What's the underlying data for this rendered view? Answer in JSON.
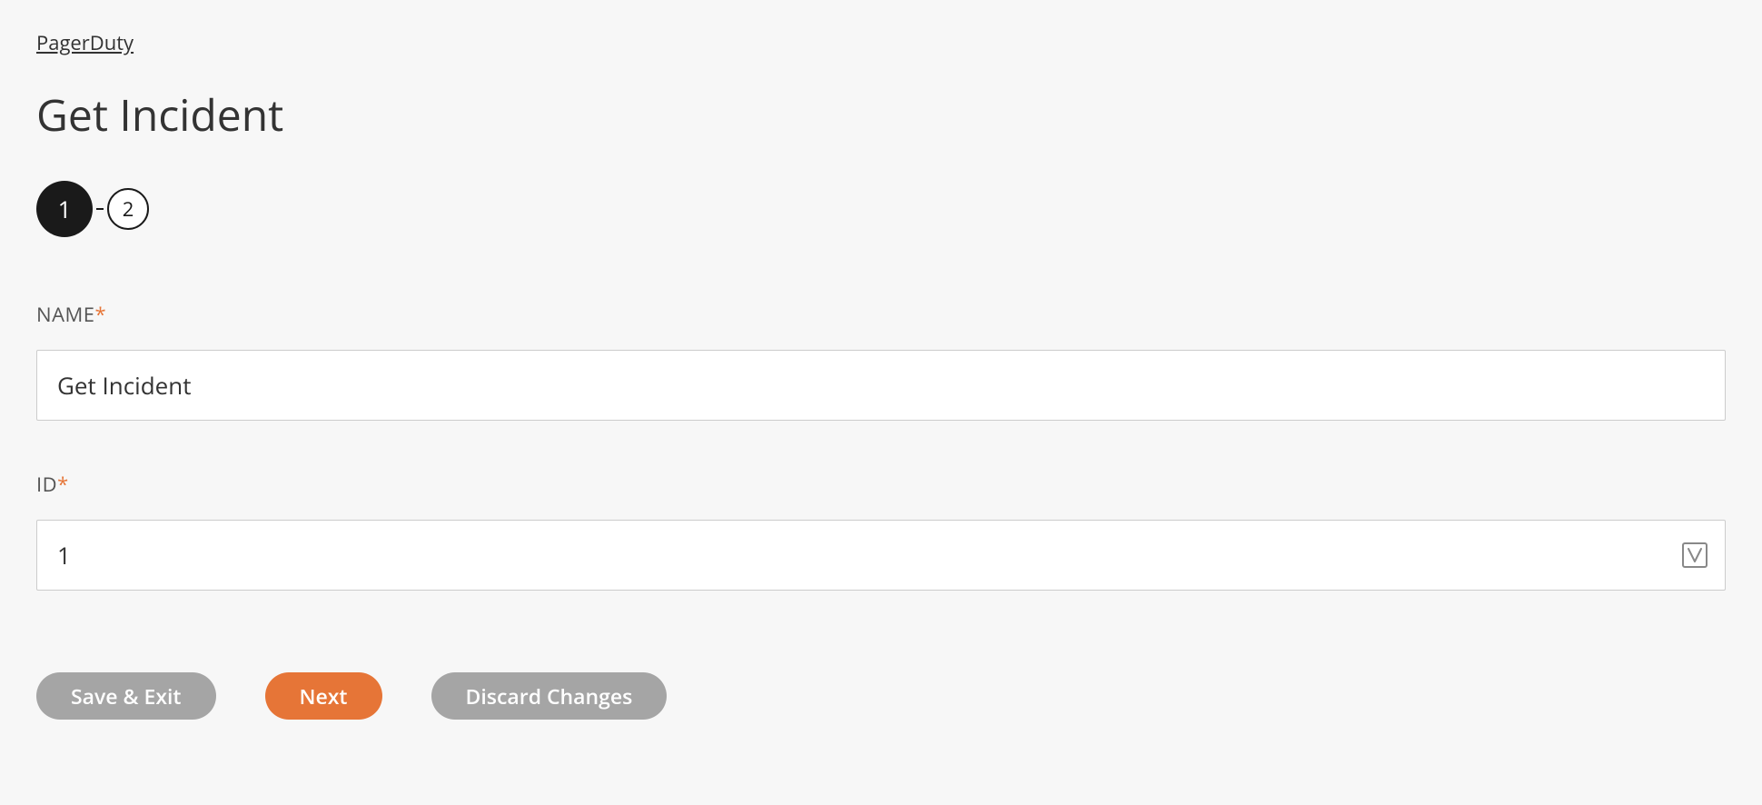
{
  "breadcrumb": "PagerDuty",
  "title": "Get Incident",
  "stepper": {
    "steps": [
      "1",
      "2"
    ],
    "activeIndex": 0
  },
  "form": {
    "name": {
      "label": "NAME",
      "required": "*",
      "value": "Get Incident"
    },
    "id": {
      "label": "ID",
      "required": "*",
      "value": "1"
    }
  },
  "buttons": {
    "saveExit": "Save & Exit",
    "next": "Next",
    "discard": "Discard Changes"
  }
}
